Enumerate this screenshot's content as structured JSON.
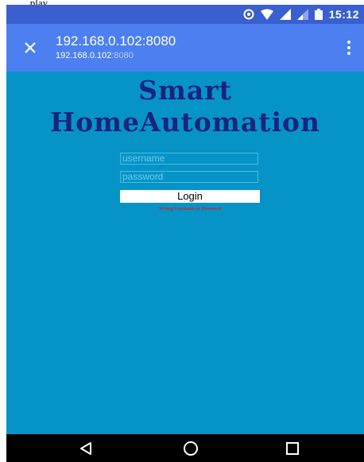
{
  "page_caption": "...play...",
  "status_bar": {
    "time": "15:12",
    "icons": [
      "sync-icon",
      "wifi-icon",
      "signal-icon",
      "signal-weak-icon",
      "battery-icon"
    ]
  },
  "url_bar": {
    "close_icon": "close-icon",
    "url_main": "192.168.0.102:8080",
    "url_host": "192.168.0.102",
    "url_port": ":8080",
    "menu_icon": "more-vert-icon"
  },
  "page": {
    "title": "Smart HomeAutomation",
    "username_placeholder": "username",
    "password_placeholder": "password",
    "login_label": "Login",
    "error_message": "Wrong Username or Password"
  },
  "nav_bar": {
    "icons": [
      "back-icon",
      "home-icon",
      "recents-icon"
    ]
  },
  "colors": {
    "page_background": "#0694c7",
    "status_bar": "#3a5fcf",
    "url_bar": "#4c7ff0",
    "title_text": "#1a237e",
    "error_text": "#c62828"
  }
}
